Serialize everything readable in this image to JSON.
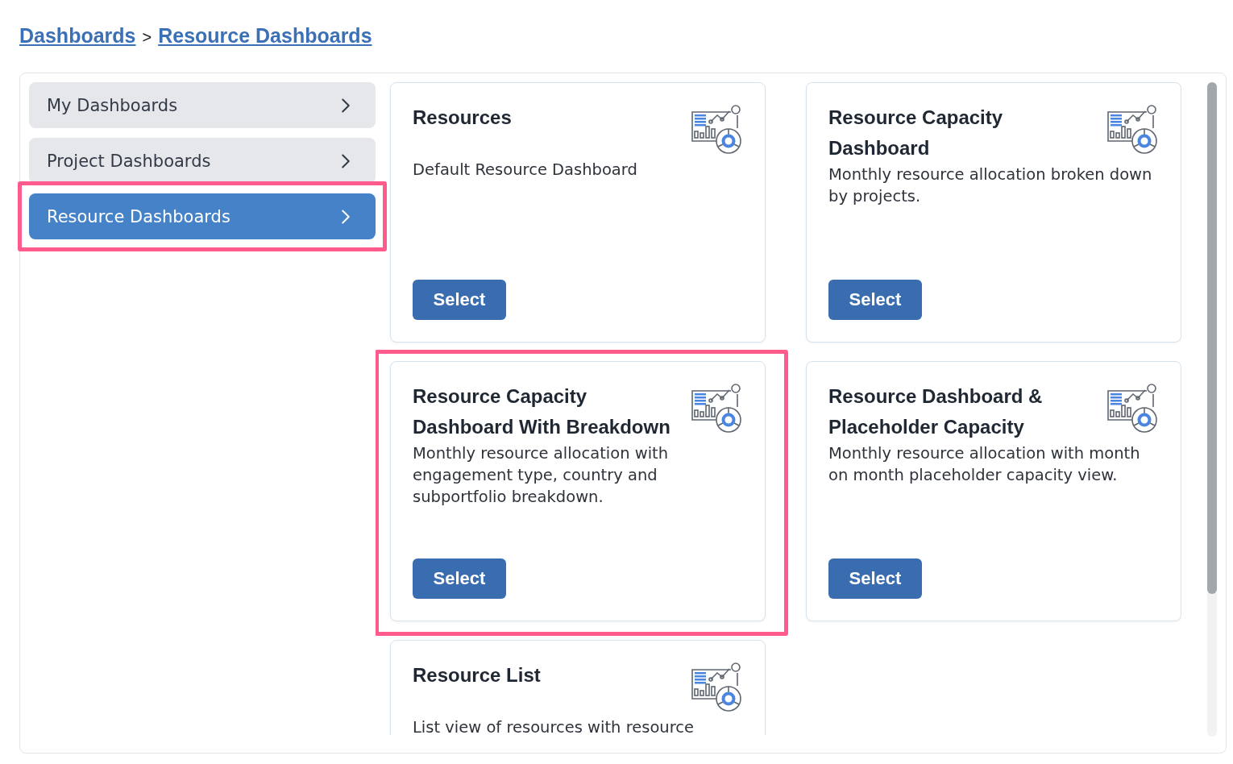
{
  "breadcrumb": [
    {
      "label": "Dashboards"
    },
    {
      "label": "Resource Dashboards"
    }
  ],
  "breadcrumb_separator": ">",
  "sidebar": {
    "items": [
      {
        "label": "My Dashboards",
        "selected": false,
        "highlighted": false
      },
      {
        "label": "Project Dashboards",
        "selected": false,
        "highlighted": false
      },
      {
        "label": "Resource Dashboards",
        "selected": true,
        "highlighted": true
      }
    ]
  },
  "cards": [
    {
      "title": "Resources",
      "description": "Default Resource Dashboard",
      "button": "Select",
      "highlighted": false
    },
    {
      "title": "Resource Capacity Dashboard",
      "description": "Monthly resource allocation broken down by projects.",
      "button": "Select",
      "highlighted": false
    },
    {
      "title": "Resource Capacity Dashboard With Breakdown",
      "description": "Monthly resource allocation with engagement type, country and subportfolio breakdown.",
      "button": "Select",
      "highlighted": true
    },
    {
      "title": "Resource Dashboard & Placeholder Capacity",
      "description": "Monthly resource allocation with month on month placeholder capacity view.",
      "button": "Select",
      "highlighted": false
    },
    {
      "title": "Resource List",
      "description": "List view of resources with resource",
      "highlighted": false
    }
  ]
}
